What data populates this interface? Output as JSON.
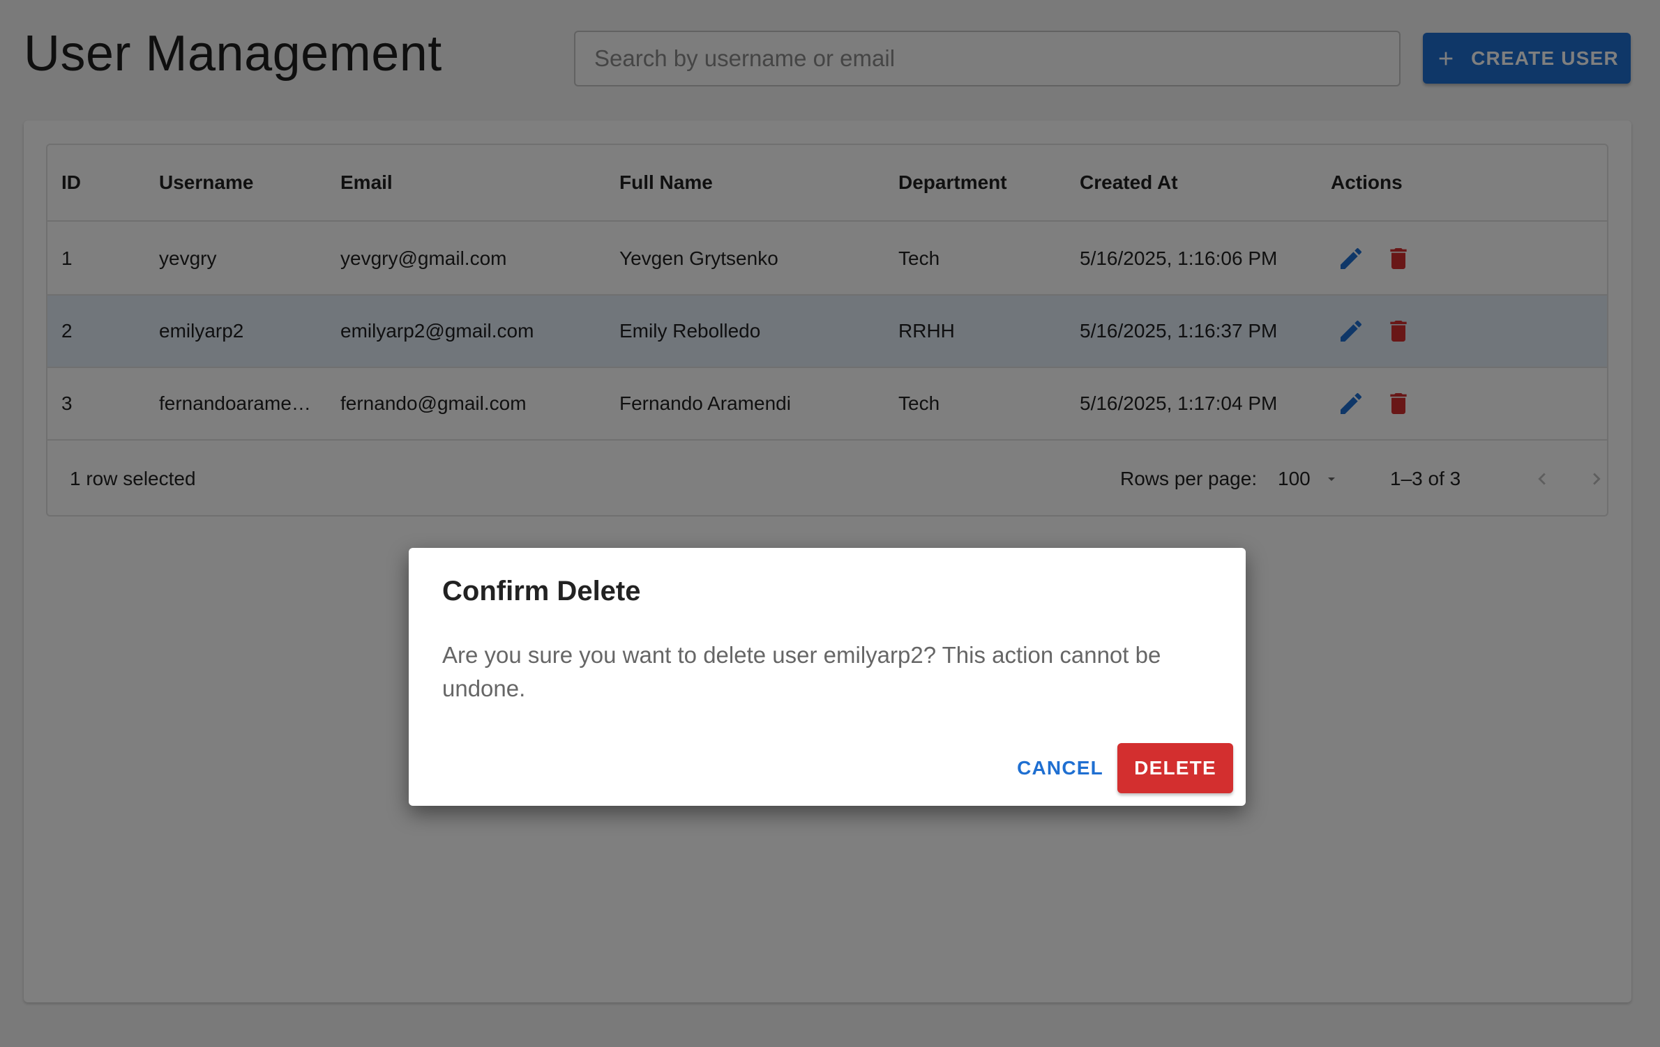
{
  "header": {
    "title": "User Management",
    "search_placeholder": "Search by username or email",
    "create_label": "CREATE USER"
  },
  "table": {
    "columns": [
      "ID",
      "Username",
      "Email",
      "Full Name",
      "Department",
      "Created At",
      "Actions"
    ],
    "rows": [
      {
        "id": "1",
        "username": "yevgry",
        "email": "yevgry@gmail.com",
        "full_name": "Yevgen Grytsenko",
        "department": "Tech",
        "created_at": "5/16/2025, 1:16:06 PM"
      },
      {
        "id": "2",
        "username": "emilyarp2",
        "email": "emilyarp2@gmail.com",
        "full_name": "Emily Rebolledo",
        "department": "RRHH",
        "created_at": "5/16/2025, 1:16:37 PM"
      },
      {
        "id": "3",
        "username": "fernandoarame…",
        "email": "fernando@gmail.com",
        "full_name": "Fernando Aramendi",
        "department": "Tech",
        "created_at": "5/16/2025, 1:17:04 PM"
      }
    ]
  },
  "footer": {
    "selected_text": "1 row selected",
    "rows_per_page_label": "Rows per page:",
    "rows_per_page_value": "100",
    "range_text": "1–3 of 3"
  },
  "dialog": {
    "title": "Confirm Delete",
    "message": "Are you sure you want to delete user emilyarp2? This action cannot be undone.",
    "cancel_label": "CANCEL",
    "delete_label": "DELETE"
  },
  "colors": {
    "primary": "#1f6fd1",
    "danger": "#d32f2f",
    "edit_icon": "#1f6fd1",
    "delete_icon": "#d32f2f",
    "selected_row": "#e3ecf7"
  },
  "icons": {
    "create": "plus-icon",
    "edit": "pencil-icon",
    "delete": "trash-icon",
    "select_arrow": "caret-down-icon",
    "prev": "chevron-left-icon",
    "next": "chevron-right-icon"
  }
}
